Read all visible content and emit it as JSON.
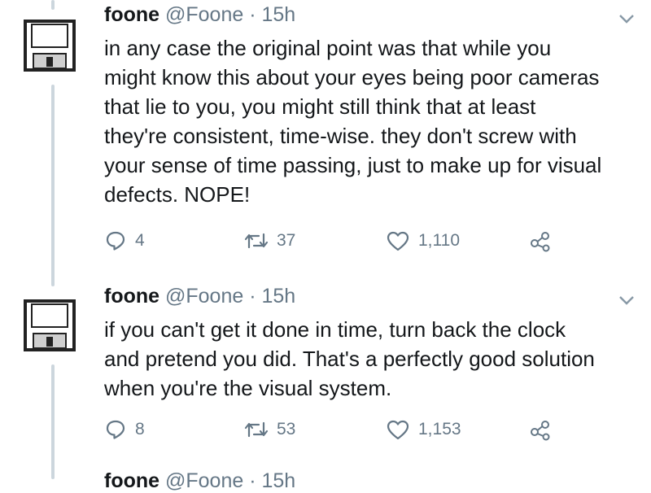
{
  "tweets": [
    {
      "name": "foone",
      "handle": "@Foone",
      "separator": "·",
      "time": "15h",
      "avatar_icon": "floppy-disk-icon",
      "text_lines": [
        "in any case the original point was that while you",
        "might know this about your eyes being poor cameras",
        "that lie to you, you might still think that at least",
        "they're consistent, time-wise. they don't screw with",
        "your sense of time passing, just to make up for visual",
        "defects. NOPE!"
      ],
      "replies": "4",
      "retweets": "37",
      "likes": "1,110"
    },
    {
      "name": "foone",
      "handle": "@Foone",
      "separator": "·",
      "time": "15h",
      "avatar_icon": "floppy-disk-icon",
      "text_lines": [
        "if you can't get it done in time, turn back the clock",
        "and pretend you did. That's a perfectly good solution",
        "when you're the visual system."
      ],
      "replies": "8",
      "retweets": "53",
      "likes": "1,153"
    }
  ],
  "next_tweet": {
    "name": "foone",
    "handle": "@Foone",
    "separator": "·",
    "time": "15h"
  },
  "colors": {
    "text": "#14171a",
    "muted": "#657786",
    "thread_line": "#ccd6dd"
  }
}
